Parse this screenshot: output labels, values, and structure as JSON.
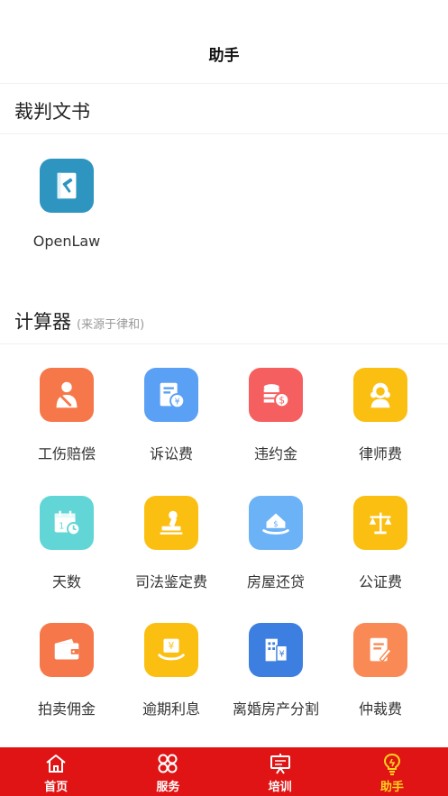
{
  "navbar": {
    "title": "助手"
  },
  "sections": {
    "judgment": {
      "title": "裁判文书"
    },
    "calculator": {
      "title": "计算器",
      "subtitle": "(来源于律和)"
    }
  },
  "judgment_items": [
    {
      "label": "OpenLaw",
      "icon": "law-book-gavel-icon",
      "color": "#2e95c0"
    }
  ],
  "calculator_items": [
    {
      "label": "工伤赔偿",
      "icon": "injured-worker-icon",
      "color": "#f6784a"
    },
    {
      "label": "诉讼费",
      "icon": "invoice-yen-icon",
      "color": "#5aa0f4"
    },
    {
      "label": "违约金",
      "icon": "coins-stack-icon",
      "color": "#f55f5f"
    },
    {
      "label": "律师费",
      "icon": "lawyer-wig-icon",
      "color": "#fbbf12"
    },
    {
      "label": "天数",
      "icon": "calendar-clock-icon",
      "color": "#62d6d6"
    },
    {
      "label": "司法鉴定费",
      "icon": "stamp-icon",
      "color": "#fbbf12"
    },
    {
      "label": "房屋还贷",
      "icon": "house-hand-icon",
      "color": "#6cb2f7"
    },
    {
      "label": "公证费",
      "icon": "scales-icon",
      "color": "#fbbf12"
    },
    {
      "label": "拍卖佣金",
      "icon": "wallet-icon",
      "color": "#f6784a"
    },
    {
      "label": "逾期利息",
      "icon": "yen-hand-icon",
      "color": "#fbbf12"
    },
    {
      "label": "离婚房产分割",
      "icon": "building-yen-icon",
      "color": "#3d7fe0"
    },
    {
      "label": "仲裁费",
      "icon": "document-pen-icon",
      "color": "#f98a55"
    }
  ],
  "tabbar": {
    "tabs": [
      {
        "label": "首页",
        "icon": "home-icon",
        "active": false
      },
      {
        "label": "服务",
        "icon": "grid-circles-icon",
        "active": false
      },
      {
        "label": "培训",
        "icon": "presentation-board-icon",
        "active": false
      },
      {
        "label": "助手",
        "icon": "lightbulb-icon",
        "active": true
      }
    ],
    "background": "#e01414",
    "active_color": "#ffd21e"
  }
}
